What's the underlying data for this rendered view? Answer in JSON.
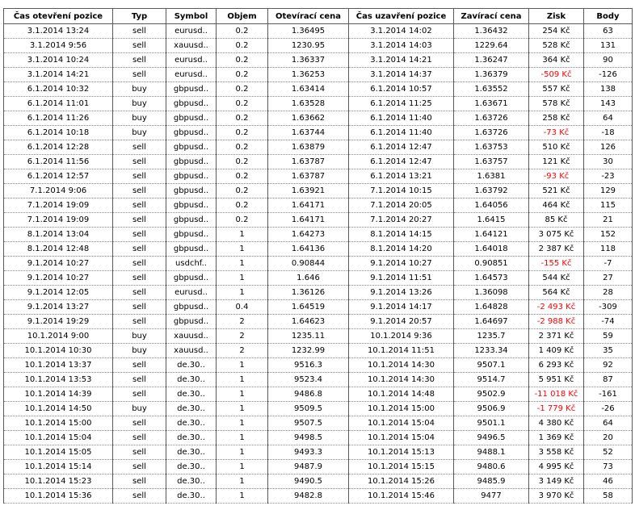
{
  "colors": {
    "negative_profit": "#ff0000",
    "border": "#5a5a5a"
  },
  "table": {
    "headers": [
      "Čas otevření pozice",
      "Typ",
      "Symbol",
      "Objem",
      "Otevírací cena",
      "Čas uzavření pozice",
      "Zavírací cena",
      "Zisk",
      "Body"
    ],
    "rows": [
      [
        "3.1.2014 13:24",
        "sell",
        "eurusd..",
        "0.2",
        "1.36495",
        "3.1.2014 14:02",
        "1.36432",
        "254 Kč",
        "63"
      ],
      [
        "3.1.2014 9:56",
        "sell",
        "xauusd..",
        "0.2",
        "1230.95",
        "3.1.2014 14:03",
        "1229.64",
        "528 Kč",
        "131"
      ],
      [
        "3.1.2014 10:24",
        "sell",
        "eurusd..",
        "0.2",
        "1.36337",
        "3.1.2014 14:21",
        "1.36247",
        "364 Kč",
        "90"
      ],
      [
        "3.1.2014 14:21",
        "sell",
        "eurusd..",
        "0.2",
        "1.36253",
        "3.1.2014 14:37",
        "1.36379",
        "-509 Kč",
        "-126"
      ],
      [
        "6.1.2014 10:32",
        "buy",
        "gbpusd..",
        "0.2",
        "1.63414",
        "6.1.2014 10:57",
        "1.63552",
        "557 Kč",
        "138"
      ],
      [
        "6.1.2014 11:01",
        "buy",
        "gbpusd..",
        "0.2",
        "1.63528",
        "6.1.2014 11:25",
        "1.63671",
        "578 Kč",
        "143"
      ],
      [
        "6.1.2014 11:26",
        "buy",
        "gbpusd..",
        "0.2",
        "1.63662",
        "6.1.2014 11:40",
        "1.63726",
        "258 Kč",
        "64"
      ],
      [
        "6.1.2014 10:18",
        "buy",
        "gbpusd..",
        "0.2",
        "1.63744",
        "6.1.2014 11:40",
        "1.63726",
        "-73 Kč",
        "-18"
      ],
      [
        "6.1.2014 12:28",
        "sell",
        "gbpusd..",
        "0.2",
        "1.63879",
        "6.1.2014 12:47",
        "1.63753",
        "510 Kč",
        "126"
      ],
      [
        "6.1.2014 11:56",
        "sell",
        "gbpusd..",
        "0.2",
        "1.63787",
        "6.1.2014 12:47",
        "1.63757",
        "121 Kč",
        "30"
      ],
      [
        "6.1.2014 12:57",
        "sell",
        "gbpusd..",
        "0.2",
        "1.63787",
        "6.1.2014 13:21",
        "1.6381",
        "-93 Kč",
        "-23"
      ],
      [
        "7.1.2014 9:06",
        "sell",
        "gbpusd..",
        "0.2",
        "1.63921",
        "7.1.2014 10:15",
        "1.63792",
        "521 Kč",
        "129"
      ],
      [
        "7.1.2014 19:09",
        "sell",
        "gbpusd..",
        "0.2",
        "1.64171",
        "7.1.2014 20:05",
        "1.64056",
        "464 Kč",
        "115"
      ],
      [
        "7.1.2014 19:09",
        "sell",
        "gbpusd..",
        "0.2",
        "1.64171",
        "7.1.2014 20:27",
        "1.6415",
        "85 Kč",
        "21"
      ],
      [
        "8.1.2014 13:04",
        "sell",
        "gbpusd..",
        "1",
        "1.64273",
        "8.1.2014 14:15",
        "1.64121",
        "3 075 Kč",
        "152"
      ],
      [
        "8.1.2014 12:48",
        "sell",
        "gbpusd..",
        "1",
        "1.64136",
        "8.1.2014 14:20",
        "1.64018",
        "2 387 Kč",
        "118"
      ],
      [
        "9.1.2014 10:27",
        "sell",
        "usdchf..",
        "1",
        "0.90844",
        "9.1.2014 10:27",
        "0.90851",
        "-155 Kč",
        "-7"
      ],
      [
        "9.1.2014 10:27",
        "sell",
        "gbpusd..",
        "1",
        "1.646",
        "9.1.2014 11:51",
        "1.64573",
        "544 Kč",
        "27"
      ],
      [
        "9.1.2014 12:05",
        "sell",
        "eurusd..",
        "1",
        "1.36126",
        "9.1.2014 13:26",
        "1.36098",
        "564 Kč",
        "28"
      ],
      [
        "9.1.2014 13:27",
        "sell",
        "gbpusd..",
        "0.4",
        "1.64519",
        "9.1.2014 14:17",
        "1.64828",
        "-2 493 Kč",
        "-309"
      ],
      [
        "9.1.2014 19:29",
        "sell",
        "gbpusd..",
        "2",
        "1.64623",
        "9.1.2014 20:57",
        "1.64697",
        "-2 988 Kč",
        "-74"
      ],
      [
        "10.1.2014 9:00",
        "buy",
        "xauusd..",
        "2",
        "1235.11",
        "10.1.2014 9:36",
        "1235.7",
        "2 371 Kč",
        "59"
      ],
      [
        "10.1.2014 10:30",
        "buy",
        "xauusd..",
        "2",
        "1232.99",
        "10.1.2014 11:51",
        "1233.34",
        "1 409 Kč",
        "35"
      ],
      [
        "10.1.2014 13:37",
        "sell",
        "de.30..",
        "1",
        "9516.3",
        "10.1.2014 14:30",
        "9507.1",
        "6 293 Kč",
        "92"
      ],
      [
        "10.1.2014 13:53",
        "sell",
        "de.30..",
        "1",
        "9523.4",
        "10.1.2014 14:30",
        "9514.7",
        "5 951 Kč",
        "87"
      ],
      [
        "10.1.2014 14:39",
        "sell",
        "de.30..",
        "1",
        "9486.8",
        "10.1.2014 14:48",
        "9502.9",
        "-11 018 Kč",
        "-161"
      ],
      [
        "10.1.2014 14:50",
        "buy",
        "de.30..",
        "1",
        "9509.5",
        "10.1.2014 15:00",
        "9506.9",
        "-1 779 Kč",
        "-26"
      ],
      [
        "10.1.2014 15:00",
        "sell",
        "de.30..",
        "1",
        "9507.5",
        "10.1.2014 15:04",
        "9501.1",
        "4 380 Kč",
        "64"
      ],
      [
        "10.1.2014 15:04",
        "sell",
        "de.30..",
        "1",
        "9498.5",
        "10.1.2014 15:04",
        "9496.5",
        "1 369 Kč",
        "20"
      ],
      [
        "10.1.2014 15:05",
        "sell",
        "de.30..",
        "1",
        "9493.3",
        "10.1.2014 15:13",
        "9488.1",
        "3 558 Kč",
        "52"
      ],
      [
        "10.1.2014 15:14",
        "sell",
        "de.30..",
        "1",
        "9487.9",
        "10.1.2014 15:15",
        "9480.6",
        "4 995 Kč",
        "73"
      ],
      [
        "10.1.2014 15:23",
        "sell",
        "de.30..",
        "1",
        "9490.5",
        "10.1.2014 15:26",
        "9485.9",
        "3 149 Kč",
        "46"
      ],
      [
        "10.1.2014 15:36",
        "sell",
        "de.30..",
        "1",
        "9482.8",
        "10.1.2014 15:46",
        "9477",
        "3 970 Kč",
        "58"
      ]
    ]
  }
}
